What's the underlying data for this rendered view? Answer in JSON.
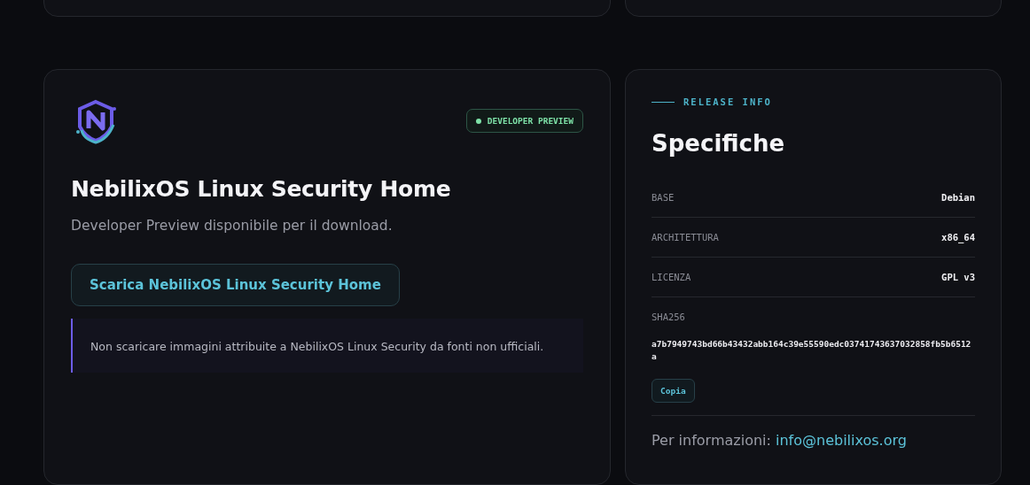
{
  "download_card": {
    "badge": {
      "label": "DEVELOPER PREVIEW",
      "color": "#7ee2a8"
    },
    "title": "NebilixOS Linux Security Home",
    "subtitle": "Developer Preview disponibile per il download.",
    "download_button": "Scarica NebilixOS Linux Security Home",
    "warning": "Non scaricare immagini attribuite a NebilixOS Linux Security da fonti non ufficiali."
  },
  "release_card": {
    "eyebrow": "RELEASE INFO",
    "title": "Specifiche",
    "specs": [
      {
        "label": "BASE",
        "value": "Debian"
      },
      {
        "label": "ARCHITETTURA",
        "value": "x86_64"
      },
      {
        "label": "LICENZA",
        "value": "GPL v3"
      }
    ],
    "hash": {
      "label": "SHA256",
      "value": "a7b7949743bd66b43432abb164c39e55590edc03741743637032858fb5b6512a",
      "copy_button": "Copia"
    },
    "contact": {
      "label": "Per informazioni:",
      "email": "info@nebilixos.org"
    }
  }
}
